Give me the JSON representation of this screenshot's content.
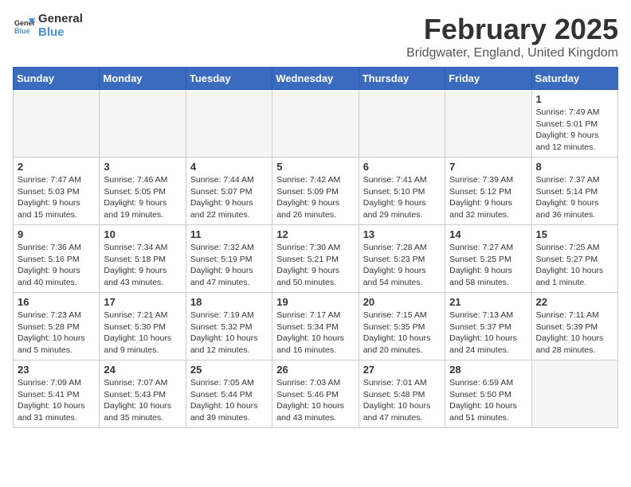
{
  "header": {
    "logo_line1": "General",
    "logo_line2": "Blue",
    "month_title": "February 2025",
    "location": "Bridgwater, England, United Kingdom"
  },
  "weekdays": [
    "Sunday",
    "Monday",
    "Tuesday",
    "Wednesday",
    "Thursday",
    "Friday",
    "Saturday"
  ],
  "weeks": [
    [
      {
        "day": "",
        "info": ""
      },
      {
        "day": "",
        "info": ""
      },
      {
        "day": "",
        "info": ""
      },
      {
        "day": "",
        "info": ""
      },
      {
        "day": "",
        "info": ""
      },
      {
        "day": "",
        "info": ""
      },
      {
        "day": "1",
        "info": "Sunrise: 7:49 AM\nSunset: 5:01 PM\nDaylight: 9 hours and 12 minutes."
      }
    ],
    [
      {
        "day": "2",
        "info": "Sunrise: 7:47 AM\nSunset: 5:03 PM\nDaylight: 9 hours and 15 minutes."
      },
      {
        "day": "3",
        "info": "Sunrise: 7:46 AM\nSunset: 5:05 PM\nDaylight: 9 hours and 19 minutes."
      },
      {
        "day": "4",
        "info": "Sunrise: 7:44 AM\nSunset: 5:07 PM\nDaylight: 9 hours and 22 minutes."
      },
      {
        "day": "5",
        "info": "Sunrise: 7:42 AM\nSunset: 5:09 PM\nDaylight: 9 hours and 26 minutes."
      },
      {
        "day": "6",
        "info": "Sunrise: 7:41 AM\nSunset: 5:10 PM\nDaylight: 9 hours and 29 minutes."
      },
      {
        "day": "7",
        "info": "Sunrise: 7:39 AM\nSunset: 5:12 PM\nDaylight: 9 hours and 32 minutes."
      },
      {
        "day": "8",
        "info": "Sunrise: 7:37 AM\nSunset: 5:14 PM\nDaylight: 9 hours and 36 minutes."
      }
    ],
    [
      {
        "day": "9",
        "info": "Sunrise: 7:36 AM\nSunset: 5:16 PM\nDaylight: 9 hours and 40 minutes."
      },
      {
        "day": "10",
        "info": "Sunrise: 7:34 AM\nSunset: 5:18 PM\nDaylight: 9 hours and 43 minutes."
      },
      {
        "day": "11",
        "info": "Sunrise: 7:32 AM\nSunset: 5:19 PM\nDaylight: 9 hours and 47 minutes."
      },
      {
        "day": "12",
        "info": "Sunrise: 7:30 AM\nSunset: 5:21 PM\nDaylight: 9 hours and 50 minutes."
      },
      {
        "day": "13",
        "info": "Sunrise: 7:28 AM\nSunset: 5:23 PM\nDaylight: 9 hours and 54 minutes."
      },
      {
        "day": "14",
        "info": "Sunrise: 7:27 AM\nSunset: 5:25 PM\nDaylight: 9 hours and 58 minutes."
      },
      {
        "day": "15",
        "info": "Sunrise: 7:25 AM\nSunset: 5:27 PM\nDaylight: 10 hours and 1 minute."
      }
    ],
    [
      {
        "day": "16",
        "info": "Sunrise: 7:23 AM\nSunset: 5:28 PM\nDaylight: 10 hours and 5 minutes."
      },
      {
        "day": "17",
        "info": "Sunrise: 7:21 AM\nSunset: 5:30 PM\nDaylight: 10 hours and 9 minutes."
      },
      {
        "day": "18",
        "info": "Sunrise: 7:19 AM\nSunset: 5:32 PM\nDaylight: 10 hours and 12 minutes."
      },
      {
        "day": "19",
        "info": "Sunrise: 7:17 AM\nSunset: 5:34 PM\nDaylight: 10 hours and 16 minutes."
      },
      {
        "day": "20",
        "info": "Sunrise: 7:15 AM\nSunset: 5:35 PM\nDaylight: 10 hours and 20 minutes."
      },
      {
        "day": "21",
        "info": "Sunrise: 7:13 AM\nSunset: 5:37 PM\nDaylight: 10 hours and 24 minutes."
      },
      {
        "day": "22",
        "info": "Sunrise: 7:11 AM\nSunset: 5:39 PM\nDaylight: 10 hours and 28 minutes."
      }
    ],
    [
      {
        "day": "23",
        "info": "Sunrise: 7:09 AM\nSunset: 5:41 PM\nDaylight: 10 hours and 31 minutes."
      },
      {
        "day": "24",
        "info": "Sunrise: 7:07 AM\nSunset: 5:43 PM\nDaylight: 10 hours and 35 minutes."
      },
      {
        "day": "25",
        "info": "Sunrise: 7:05 AM\nSunset: 5:44 PM\nDaylight: 10 hours and 39 minutes."
      },
      {
        "day": "26",
        "info": "Sunrise: 7:03 AM\nSunset: 5:46 PM\nDaylight: 10 hours and 43 minutes."
      },
      {
        "day": "27",
        "info": "Sunrise: 7:01 AM\nSunset: 5:48 PM\nDaylight: 10 hours and 47 minutes."
      },
      {
        "day": "28",
        "info": "Sunrise: 6:59 AM\nSunset: 5:50 PM\nDaylight: 10 hours and 51 minutes."
      },
      {
        "day": "",
        "info": ""
      }
    ]
  ]
}
